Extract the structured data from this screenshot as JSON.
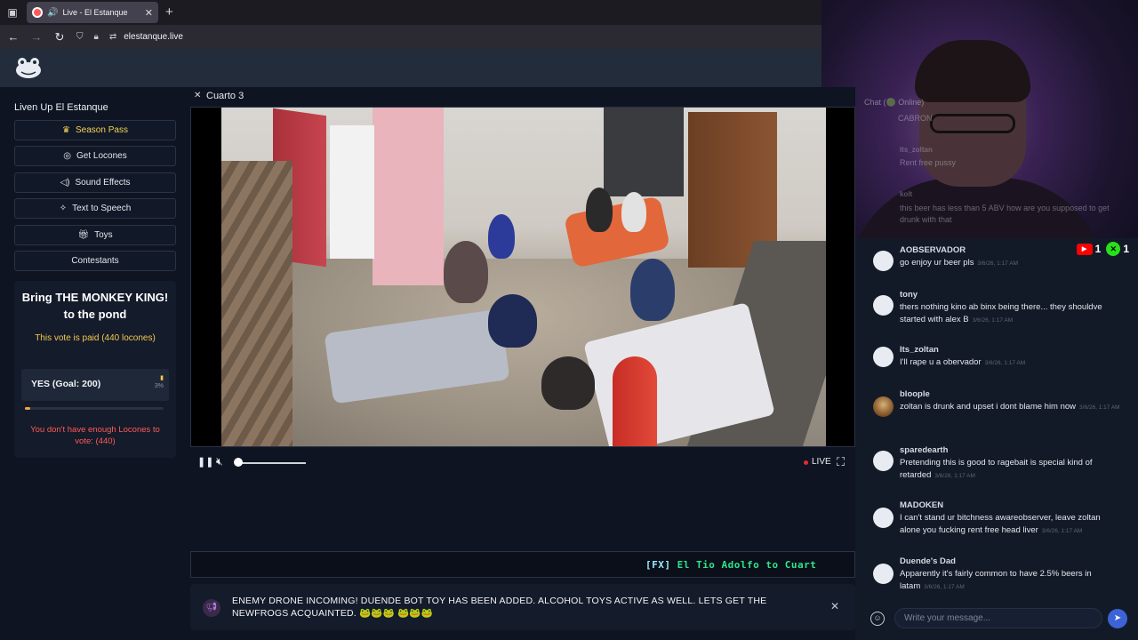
{
  "browser": {
    "tab_title": "Live - El Estanque",
    "url": "elestanque.live"
  },
  "sidebar": {
    "title": "Liven Up El Estanque",
    "items": [
      {
        "label": "Season Pass",
        "icon": "crown-icon"
      },
      {
        "label": "Get Locones",
        "icon": "coin-icon"
      },
      {
        "label": "Sound Effects",
        "icon": "speaker-icon"
      },
      {
        "label": "Text to Speech",
        "icon": "sparkle-icon"
      },
      {
        "label": "Toys",
        "icon": "gift-icon"
      },
      {
        "label": "Contestants",
        "icon": ""
      }
    ],
    "vote": {
      "title": "Bring THE MONKEY KING! to the pond",
      "paid_note": "This vote is paid (440 locones)",
      "option_label": "YES (Goal: 200)",
      "option_count": "3%",
      "progress_fraction": 0.03,
      "warning": "You don't have enough Locones to vote: (440)"
    }
  },
  "video": {
    "room_name": "Cuarto 3",
    "live_label": "LIVE",
    "volume_fraction": 0.0
  },
  "ticker": {
    "fx_tag": "[FX]",
    "text": "El Tio Adolfo to Cuart"
  },
  "announcement": {
    "message": "ENEMY DRONE INCOMING! DUENDE BOT TOY HAS BEEN ADDED. ALCOHOL TOYS ACTIVE AS WELL. LETS GET THE NEWFROGS ACQUAINTED. 🐸🐸🐸 🐸🐸🐸"
  },
  "chat": {
    "header": "Chat (🟢 Online)",
    "youtube_count": "1",
    "kick_count": "1",
    "ghost_messages": [
      {
        "user": "",
        "text": "CABRON"
      },
      {
        "user": "Its_zoltan",
        "text": "Rent free pussy"
      },
      {
        "user": "kolt",
        "text": "this beer has less than 5 ABV how are you supposed to get drunk with that"
      }
    ],
    "messages": [
      {
        "user": "AOBSERVADOR",
        "text": "go enjoy ur beer pls",
        "ts": "3/6/26, 1:17 AM"
      },
      {
        "user": "tony",
        "text": "thers nothing kino ab binx being there... they shouldve started with alex B",
        "ts": "3/6/26, 1:17 AM"
      },
      {
        "user": "Its_zoltan",
        "text": "I'll rape u a obervador",
        "ts": "3/6/26, 1:17 AM"
      },
      {
        "user": "bloople",
        "text": "zoltan is drunk and upset i dont blame him now",
        "ts": "3/6/26, 1:17 AM"
      },
      {
        "user": "sparedearth",
        "text": "Pretending this is good to ragebait is special kind of retarded",
        "ts": "3/6/26, 1:17 AM"
      },
      {
        "user": "MADOKEN",
        "text": "I can't stand ur bitchness awareobserver, leave zoltan alone you fucking rent free head liver",
        "ts": "3/6/26, 1:17 AM"
      },
      {
        "user": "Duende's Dad",
        "text": "Apparently it's fairly common to have 2.5% beers in latam",
        "ts": "3/6/26, 1:17 AM"
      }
    ],
    "input_placeholder": "Write your message..."
  },
  "colors": {
    "accent_gold": "#f4d257",
    "warn_red": "#ff5a5a",
    "ticker_green": "#2fe38d",
    "send_blue": "#3d63d8"
  }
}
